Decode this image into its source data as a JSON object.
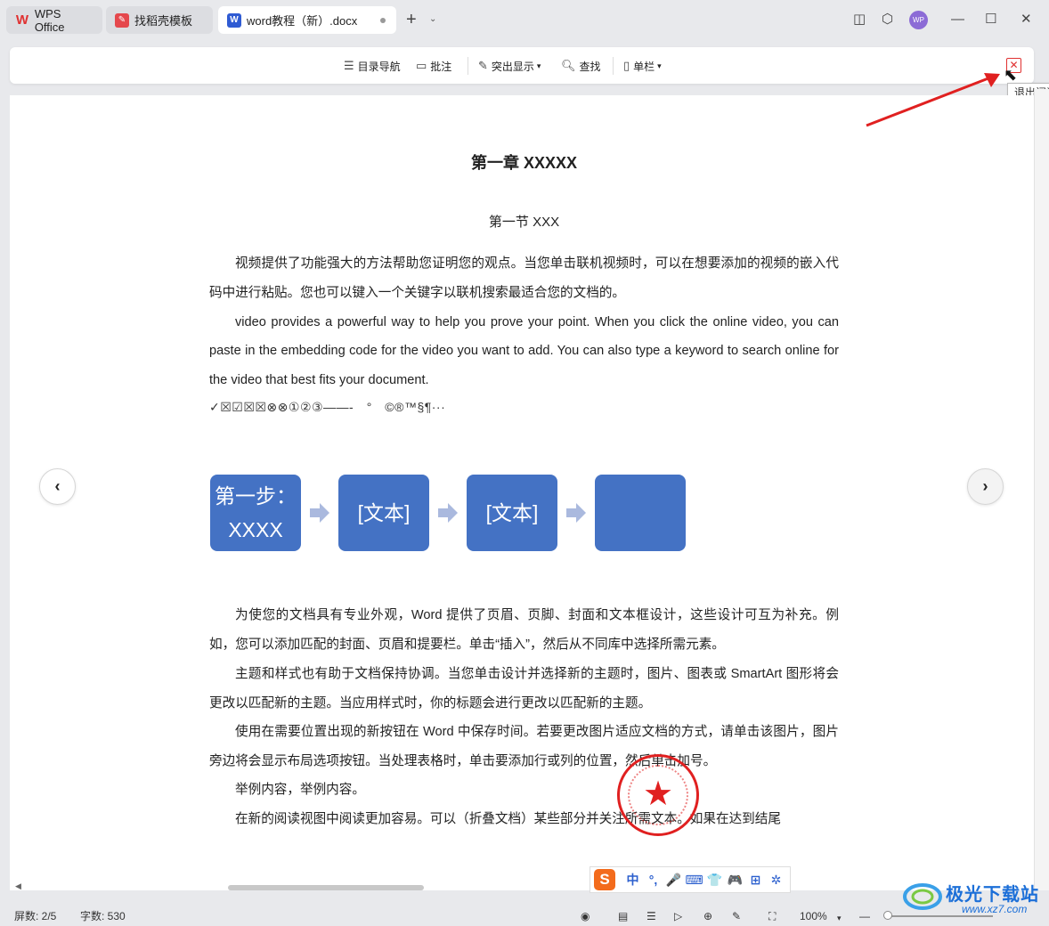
{
  "tabs": [
    {
      "label": "WPS Office",
      "icon": "wps-logo-icon"
    },
    {
      "label": "找稻壳模板",
      "icon": "docer-icon"
    },
    {
      "label": "word教程（新）.docx",
      "icon": "word-doc-icon",
      "active": true
    }
  ],
  "avatar": {
    "text": "WP"
  },
  "toolbar": {
    "items": [
      {
        "label": "目录导航",
        "icon": "toc-icon"
      },
      {
        "label": "批注",
        "icon": "comment-icon"
      },
      {
        "label": "突出显示",
        "icon": "highlight-icon",
        "dropdown": true
      },
      {
        "label": "查找",
        "icon": "search-icon"
      },
      {
        "label": "单栏",
        "icon": "column-icon",
        "dropdown": true
      }
    ],
    "exit_tooltip": "退出阅读"
  },
  "document": {
    "title": "第一章  XXXXX",
    "section": "第一节  XXX",
    "paragraphs": [
      "视频提供了功能强大的方法帮助您证明您的观点。当您单击联机视频时，可以在想要添加的视频的嵌入代码中进行粘贴。您也可以键入一个关键字以联机搜索最适合您的文档的。",
      "video provides a powerful way to help you prove your point. When you click the online video, you can paste in the embedding code for the video you want to add. You can also type a keyword to search online for the video that best fits your document."
    ],
    "symbols_line": "✓☒☑☒☒⊗⊗①②③——-　°　©®™§¶···",
    "smartart": [
      "第一步：XXXX",
      "[文本]",
      "[文本]",
      ""
    ],
    "paragraphs2": [
      "为使您的文档具有专业外观，Word 提供了页眉、页脚、封面和文本框设计，这些设计可互为补充。例如，您可以添加匹配的封面、页眉和提要栏。单击“插入”，然后从不同库中选择所需元素。",
      "主题和样式也有助于文档保持协调。当您单击设计并选择新的主题时，图片、图表或 SmartArt 图形将会更改以匹配新的主题。当应用样式时，你的标题会进行更改以匹配新的主题。",
      "使用在需要位置出现的新按钮在 Word 中保存时间。若要更改图片适应文档的方式，请单击该图片，图片旁边将会显示布局选项按钮。当处理表格时，单击要添加行或列的位置，然后单击加号。",
      "举例内容，举例内容。",
      "在新的阅读视图中阅读更加容易。可以（折叠文档）某些部分并关注所需文本。如果在达到结尾"
    ]
  },
  "ime_bar": {
    "logo": "S",
    "items": [
      "中",
      "°,",
      "🎤",
      "⌨",
      "👕",
      "🎮",
      "⊞",
      "✲"
    ]
  },
  "statusbar": {
    "page": "屏数: 2/5",
    "words": "字数: 530",
    "zoom": "100%"
  },
  "watermark": {
    "title": "极光下载站",
    "url": "www.xz7.com"
  },
  "colors": {
    "accent": "#4472c4",
    "stamp": "#e02020",
    "arrow": "#e02020"
  }
}
